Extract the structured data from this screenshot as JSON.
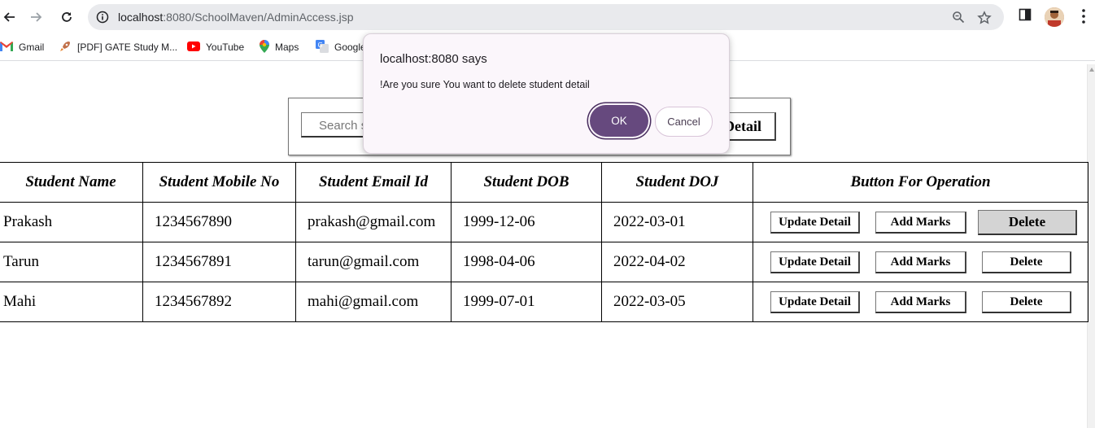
{
  "browser": {
    "url_host": "localhost",
    "url_path": ":8080/SchoolMaven/AdminAccess.jsp",
    "bookmarks": [
      {
        "label": "Gmail",
        "icon": "gmail-icon"
      },
      {
        "label": "[PDF] GATE Study M...",
        "icon": "rocket-icon"
      },
      {
        "label": "YouTube",
        "icon": "youtube-icon"
      },
      {
        "label": "Maps",
        "icon": "maps-pin-icon"
      },
      {
        "label": "Google",
        "icon": "translate-icon"
      }
    ]
  },
  "search": {
    "placeholder": "Search s",
    "button_label": "Detail"
  },
  "table": {
    "headers": [
      "Student Name",
      "Student Mobile No",
      "Student Email Id",
      "Student DOB",
      "Student DOJ",
      "Button For Operation"
    ],
    "rows": [
      {
        "name": "Prakash",
        "mobile": "1234567890",
        "email": "prakash@gmail.com",
        "dob": "1999-12-06",
        "doj": "2022-03-01"
      },
      {
        "name": "Tarun",
        "mobile": "1234567891",
        "email": "tarun@gmail.com",
        "dob": "1998-04-06",
        "doj": "2022-04-02"
      },
      {
        "name": "Mahi",
        "mobile": "1234567892",
        "email": "mahi@gmail.com",
        "dob": "1999-07-01",
        "doj": "2022-03-05"
      }
    ],
    "buttons": {
      "update": "Update Detail",
      "marks": "Add Marks",
      "delete": "Delete"
    }
  },
  "dialog": {
    "title": "localhost:8080 says",
    "message": "!Are you sure You want to delete student detail",
    "ok_label": "OK",
    "cancel_label": "Cancel"
  }
}
